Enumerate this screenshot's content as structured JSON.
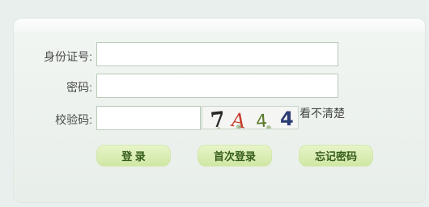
{
  "form": {
    "id_label": "身份证号:",
    "id_value": "",
    "password_label": "密码:",
    "password_value": "",
    "captcha_label": "校验码:",
    "captcha_value": "",
    "captcha_text": "7A44",
    "refresh_link": "看不清楚"
  },
  "buttons": {
    "login": "登 录",
    "first_login": "首次登录",
    "forgot_password": "忘记密码"
  },
  "colors": {
    "button_text": "#355c1a",
    "button_bg": "#d8ebb4",
    "field_border": "#b8cbb9",
    "background": "#e9efec"
  }
}
